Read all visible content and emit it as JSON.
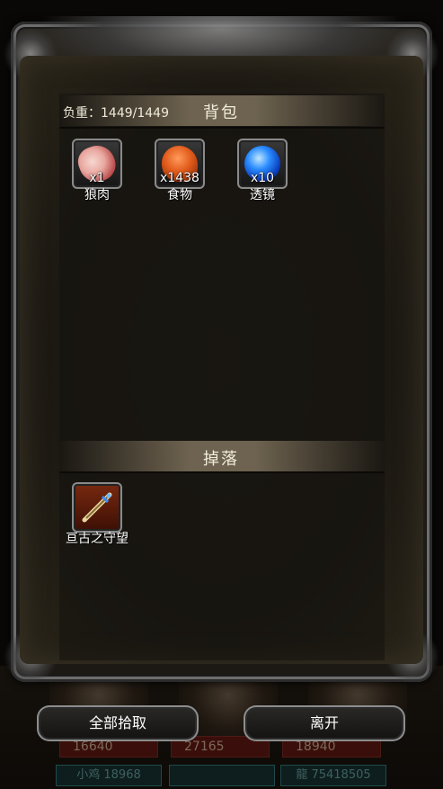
{
  "party_stats": [
    "16640",
    "27165",
    "18940"
  ],
  "party_names": [
    "小鸡 18968",
    "",
    "龍 75418505"
  ],
  "inventory": {
    "title": "背包",
    "weight": "负重：1449/1449",
    "items": [
      {
        "count": "x1",
        "name": "狼肉",
        "icon": "meat-icon"
      },
      {
        "count": "x1438",
        "name": "食物",
        "icon": "food-icon"
      },
      {
        "count": "x10",
        "name": "透镜",
        "icon": "lens-icon"
      }
    ]
  },
  "drops": {
    "title": "掉落",
    "items": [
      {
        "name": "亘古之守望",
        "icon": "sword-icon"
      }
    ]
  },
  "buttons": {
    "pickup_all": "全部拾取",
    "leave": "离开"
  }
}
